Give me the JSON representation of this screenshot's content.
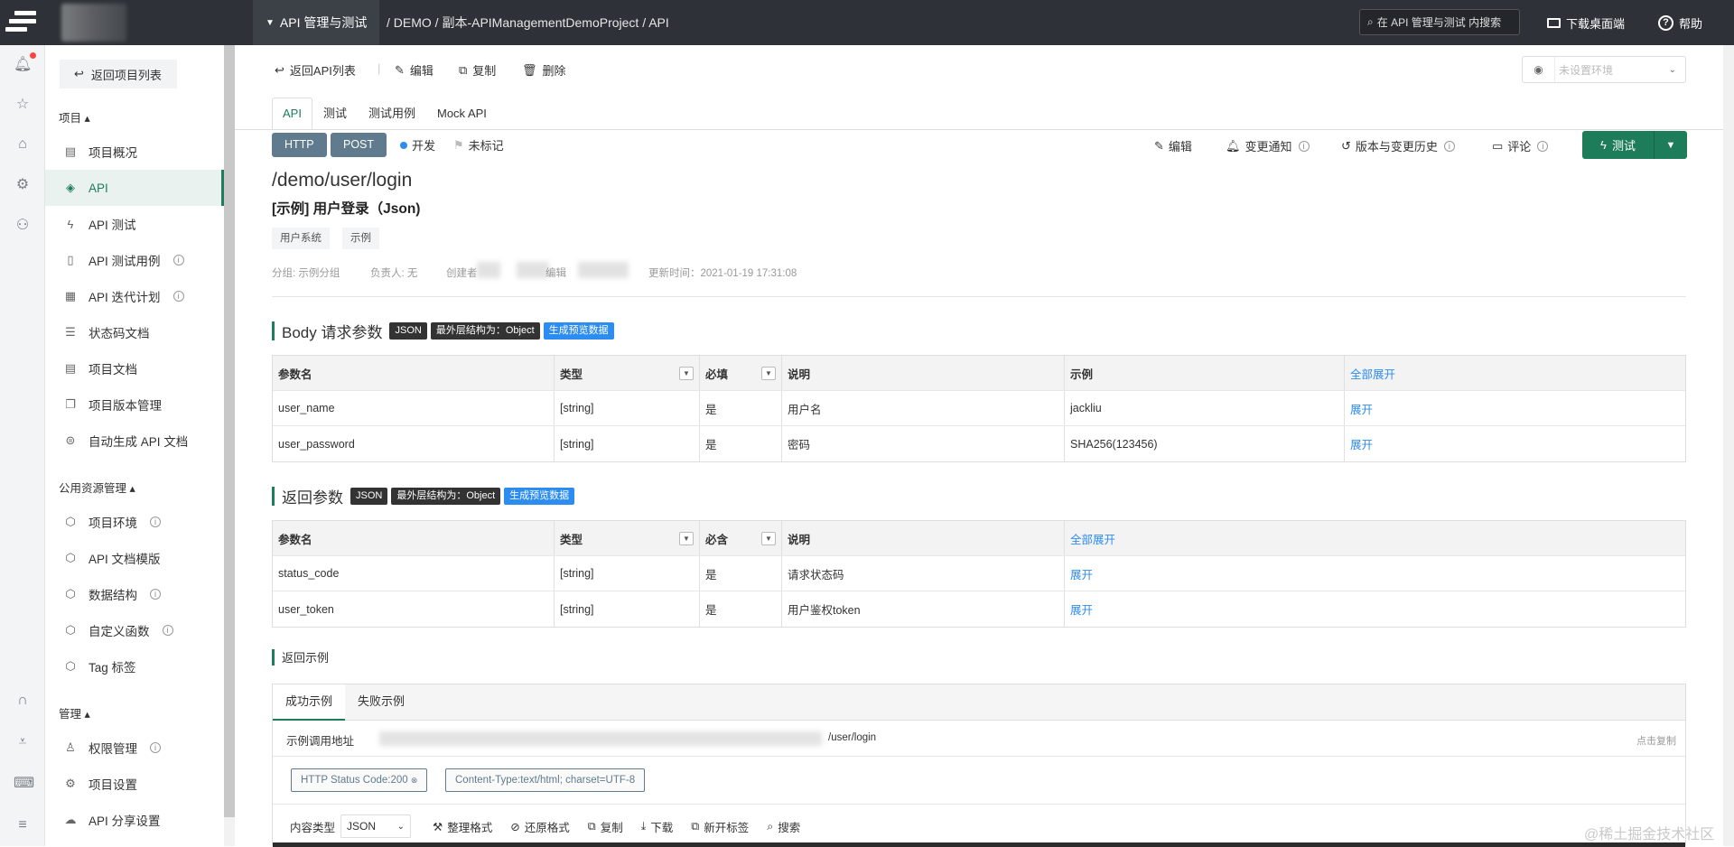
{
  "topbar": {
    "module": "API 管理与测试",
    "breadcrumb": "/ DEMO / 副本-APIManagementDemoProject / API",
    "search_placeholder": "在 API 管理与测试 内搜索",
    "download": "下载桌面端",
    "help": "帮助"
  },
  "sidebar": {
    "back": "返回项目列表",
    "section_project": "项目",
    "items": [
      {
        "label": "项目概况",
        "icon": "overview-icon"
      },
      {
        "label": "API",
        "icon": "api-icon"
      },
      {
        "label": "API 测试",
        "icon": "lightning-icon"
      },
      {
        "label": "API 测试用例",
        "icon": "testcase-icon"
      },
      {
        "label": "API 迭代计划",
        "icon": "calendar-icon"
      },
      {
        "label": "状态码文档",
        "icon": "doc-icon"
      },
      {
        "label": "项目文档",
        "icon": "doc-icon"
      },
      {
        "label": "项目版本管理",
        "icon": "version-icon"
      },
      {
        "label": "自动生成 API 文档",
        "icon": "robot-icon"
      }
    ],
    "section_public": "公用资源管理",
    "public_items": [
      {
        "label": "项目环境"
      },
      {
        "label": "API 文档模版"
      },
      {
        "label": "数据结构"
      },
      {
        "label": "自定义函数"
      },
      {
        "label": "Tag 标签"
      }
    ],
    "section_admin": "管理",
    "admin_items": [
      {
        "label": "权限管理"
      },
      {
        "label": "项目设置"
      },
      {
        "label": "API 分享设置"
      }
    ]
  },
  "toolbar": {
    "back": "返回API列表",
    "edit": "编辑",
    "copy": "复制",
    "delete": "删除",
    "env_placeholder": "未设置环境"
  },
  "tabs": [
    "API",
    "测试",
    "测试用例",
    "Mock API"
  ],
  "api": {
    "protocol": "HTTP",
    "method": "POST",
    "status": "开发",
    "mark": "未标记",
    "path": "/demo/user/login",
    "title": "[示例] 用户登录（Json)",
    "tags": [
      "用户系统",
      "示例"
    ],
    "group": "分组: 示例分组",
    "owner": "负责人: 无",
    "creator": "创建者",
    "editor": "编辑",
    "updated": "更新时间：2021-01-19 17:31:08"
  },
  "actions": {
    "edit": "编辑",
    "notify": "变更通知",
    "history": "版本与变更历史",
    "comment": "评论",
    "test": "测试"
  },
  "body_params": {
    "title": "Body 请求参数",
    "badge_json": "JSON",
    "badge_struct": "最外层结构为：Object",
    "badge_gen": "生成预览数据",
    "headers": [
      "参数名",
      "类型",
      "必填",
      "说明",
      "示例",
      "全部展开"
    ],
    "rows": [
      {
        "name": "user_name",
        "type": "[string]",
        "required": "是",
        "desc": "用户名",
        "example": "jackliu",
        "action": "展开"
      },
      {
        "name": "user_password",
        "type": "[string]",
        "required": "是",
        "desc": "密码",
        "example": "SHA256(123456)",
        "action": "展开"
      }
    ]
  },
  "return_params": {
    "title": "返回参数",
    "badge_json": "JSON",
    "badge_struct": "最外层结构为：Object",
    "badge_gen": "生成预览数据",
    "headers": [
      "参数名",
      "类型",
      "必含",
      "说明",
      "全部展开"
    ],
    "rows": [
      {
        "name": "status_code",
        "type": "[string]",
        "required": "是",
        "desc": "请求状态码",
        "action": "展开"
      },
      {
        "name": "user_token",
        "type": "[string]",
        "required": "是",
        "desc": "用户鉴权token",
        "action": "展开"
      }
    ]
  },
  "return_example": {
    "title": "返回示例",
    "tabs": [
      "成功示例",
      "失败示例"
    ],
    "url_label": "示例调用地址",
    "url_suffix": "/user/login",
    "copy": "点击复制",
    "status_code": "HTTP Status Code:200",
    "content_type": "Content-Type:text/html; charset=UTF-8",
    "type_label": "内容类型",
    "type_value": "JSON",
    "tools": [
      "整理格式",
      "还原格式",
      "复制",
      "下载",
      "新开标签",
      "搜索"
    ]
  },
  "watermark": "@稀土掘金技术社区"
}
